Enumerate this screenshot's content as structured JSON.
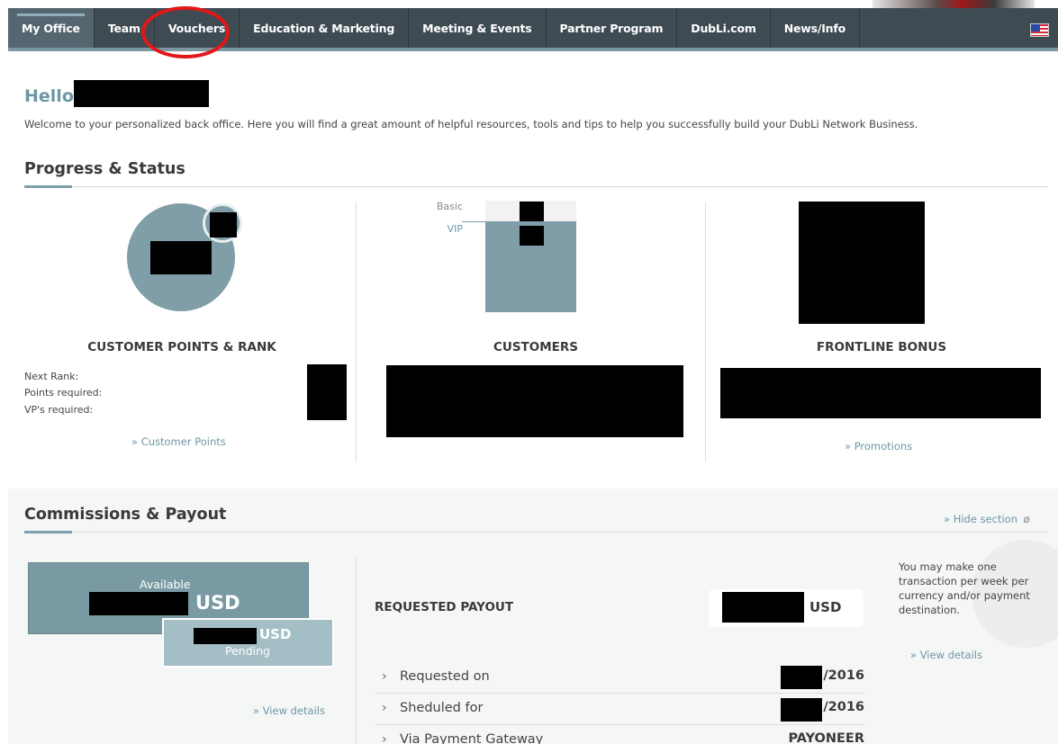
{
  "nav": {
    "items": [
      "My Office",
      "Team",
      "Vouchers",
      "Education & Marketing",
      "Meeting & Events",
      "Partner Program",
      "DubLi.com",
      "News/Info"
    ],
    "active_index": 0,
    "flag": "us-flag-icon"
  },
  "greeting": "Hello",
  "welcome_text": "Welcome to your personalized back office. Here you will find a great amount of helpful resources, tools and tips to help you successfully build your DubLi Network Business.",
  "progress": {
    "title": "Progress & Status",
    "points": {
      "title": "CUSTOMER POINTS & RANK",
      "labels": [
        "Next Rank:",
        "Points required:",
        "VP's required:"
      ],
      "link": "» Customer Points"
    },
    "customers": {
      "title": "CUSTOMERS",
      "bar_labels": [
        "Basic",
        "VIP"
      ]
    },
    "frontline": {
      "title": "FRONTLINE BONUS",
      "link": "» Promotions"
    }
  },
  "commissions": {
    "title": "Commissions & Payout",
    "hide_link": "» Hide section",
    "available_label": "Available",
    "available_currency": "USD",
    "pending_label": "Pending",
    "pending_currency": "USD",
    "view_details_left": "» View details",
    "requested_payout_label": "REQUESTED PAYOUT",
    "requested_payout_currency": "USD",
    "rows": [
      {
        "label": "Requested on",
        "value": "/2016"
      },
      {
        "label": "Sheduled for",
        "value": "/2016"
      },
      {
        "label": "Via Payment Gateway",
        "value": "PAYONEER"
      }
    ],
    "note": "You may make one transaction per week per currency and/or payment destination.",
    "view_details_right": "» View details"
  },
  "colors": {
    "nav_bg": "#3f4b53",
    "accent": "#7f9ea7",
    "link": "#6d97a5",
    "highlight_circle": "#e01818"
  }
}
